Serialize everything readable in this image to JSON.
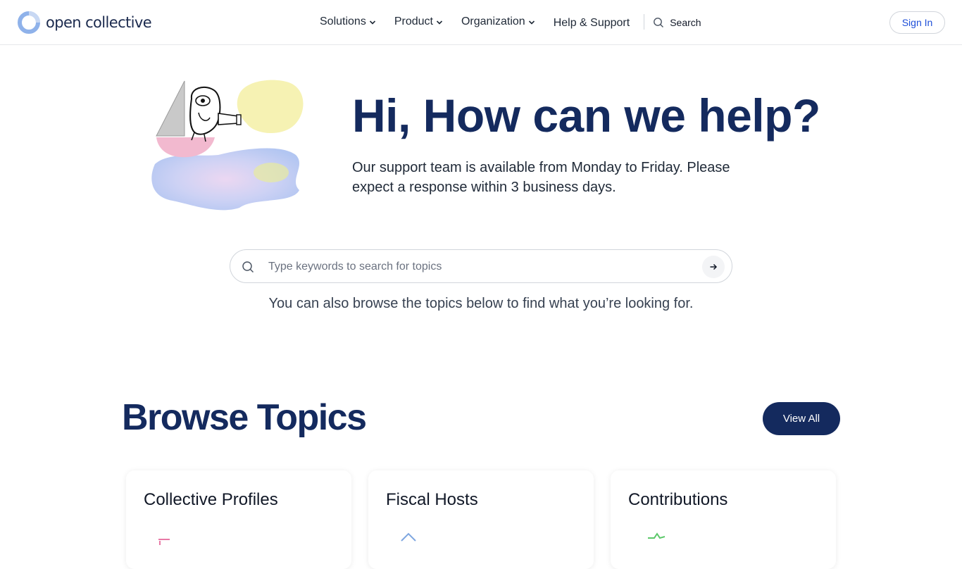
{
  "header": {
    "logo_text": "open collective",
    "nav": {
      "solutions": "Solutions",
      "product": "Product",
      "organization": "Organization",
      "help": "Help & Support",
      "search": "Search"
    },
    "sign_in": "Sign In"
  },
  "hero": {
    "title": "Hi, How can we help?",
    "subtitle": "Our support team is available from Monday to Friday. Please expect a response within 3 business days."
  },
  "search": {
    "placeholder": "Type keywords to search for topics",
    "value": ""
  },
  "browse_hint": "You can also browse the topics below to find what you’re looking for.",
  "browse": {
    "title": "Browse Topics",
    "view_all": "View All",
    "cards": [
      {
        "title": "Collective Profiles",
        "icon": "profile-icon"
      },
      {
        "title": "Fiscal Hosts",
        "icon": "house-icon"
      },
      {
        "title": "Contributions",
        "icon": "star-icon"
      }
    ]
  },
  "colors": {
    "brand_navy": "#142a5e",
    "link_blue": "#1d4ed8"
  }
}
